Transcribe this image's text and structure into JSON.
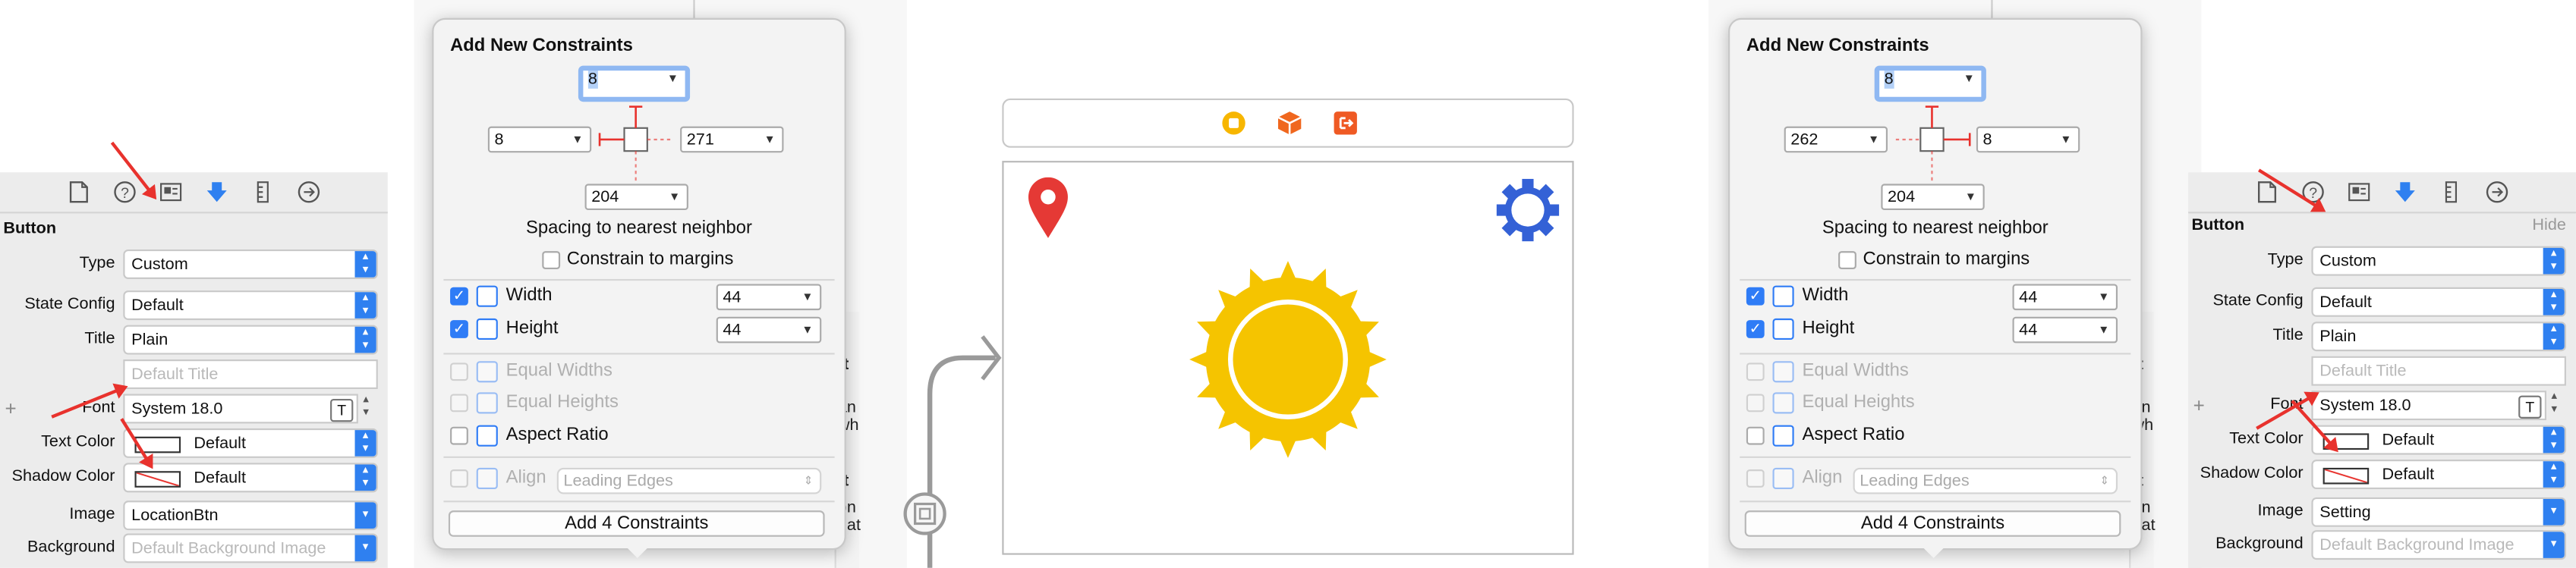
{
  "left_inspector": {
    "section": "Button",
    "rows": [
      {
        "label": "Type",
        "value": "Custom"
      },
      {
        "label": "State Config",
        "value": "Default"
      },
      {
        "label": "Title",
        "value": "Plain"
      },
      {
        "label": "",
        "placeholder": "Default Title"
      },
      {
        "label": "Font",
        "value": "System 18.0"
      },
      {
        "label": "Text Color",
        "value": "Default"
      },
      {
        "label": "Shadow Color",
        "value": "Default"
      },
      {
        "label": "Image",
        "value": "LocationBtn"
      },
      {
        "label": "Background",
        "placeholder": "Default Background Image"
      }
    ]
  },
  "right_inspector": {
    "section": "Button",
    "hide": "Hide",
    "rows": [
      {
        "label": "Type",
        "value": "Custom"
      },
      {
        "label": "State Config",
        "value": "Default"
      },
      {
        "label": "Title",
        "value": "Plain"
      },
      {
        "label": "",
        "placeholder": "Default Title"
      },
      {
        "label": "Font",
        "value": "System 18.0"
      },
      {
        "label": "Text Color",
        "value": "Default"
      },
      {
        "label": "Shadow Color",
        "value": "Default"
      },
      {
        "label": "Image",
        "value": "Setting"
      },
      {
        "label": "Background",
        "placeholder": "Default Background Image"
      }
    ]
  },
  "left_constraints": {
    "title": "Add New Constraints",
    "top": "8",
    "left": "8",
    "right": "271",
    "bottom": "204",
    "spacing_label": "Spacing to nearest neighbor",
    "margins_label": "Constrain to margins",
    "width_label": "Width",
    "width_value": "44",
    "height_label": "Height",
    "height_value": "44",
    "equal_widths": "Equal Widths",
    "equal_heights": "Equal Heights",
    "aspect_ratio": "Aspect Ratio",
    "align_label": "Align",
    "align_value": "Leading Edges",
    "add_button": "Add 4 Constraints"
  },
  "right_constraints": {
    "title": "Add New Constraints",
    "top": "8",
    "left": "262",
    "right": "8",
    "bottom": "204",
    "spacing_label": "Spacing to nearest neighbor",
    "margins_label": "Constrain to margins",
    "width_label": "Width",
    "width_value": "44",
    "height_label": "Height",
    "height_value": "44",
    "equal_widths": "Equal Widths",
    "equal_heights": "Equal Heights",
    "aspect_ratio": "Aspect Ratio",
    "align_label": "Align",
    "align_value": "Leading Edges",
    "add_button": "Add 4 Constraints"
  },
  "background_fragments": [
    "tt",
    "an",
    "wh",
    "tt",
    "bn",
    "gat"
  ],
  "colors": {
    "accent": "#2f80f0",
    "sun": "#f5c400",
    "pin": "#e53935",
    "gear": "#3461d6",
    "arrow": "#e8322d"
  },
  "icons": [
    "file-icon",
    "help-icon",
    "identity-icon",
    "attributes-icon",
    "size-icon",
    "connections-icon",
    "location-pin-icon",
    "settings-gear-icon",
    "sun-icon"
  ]
}
